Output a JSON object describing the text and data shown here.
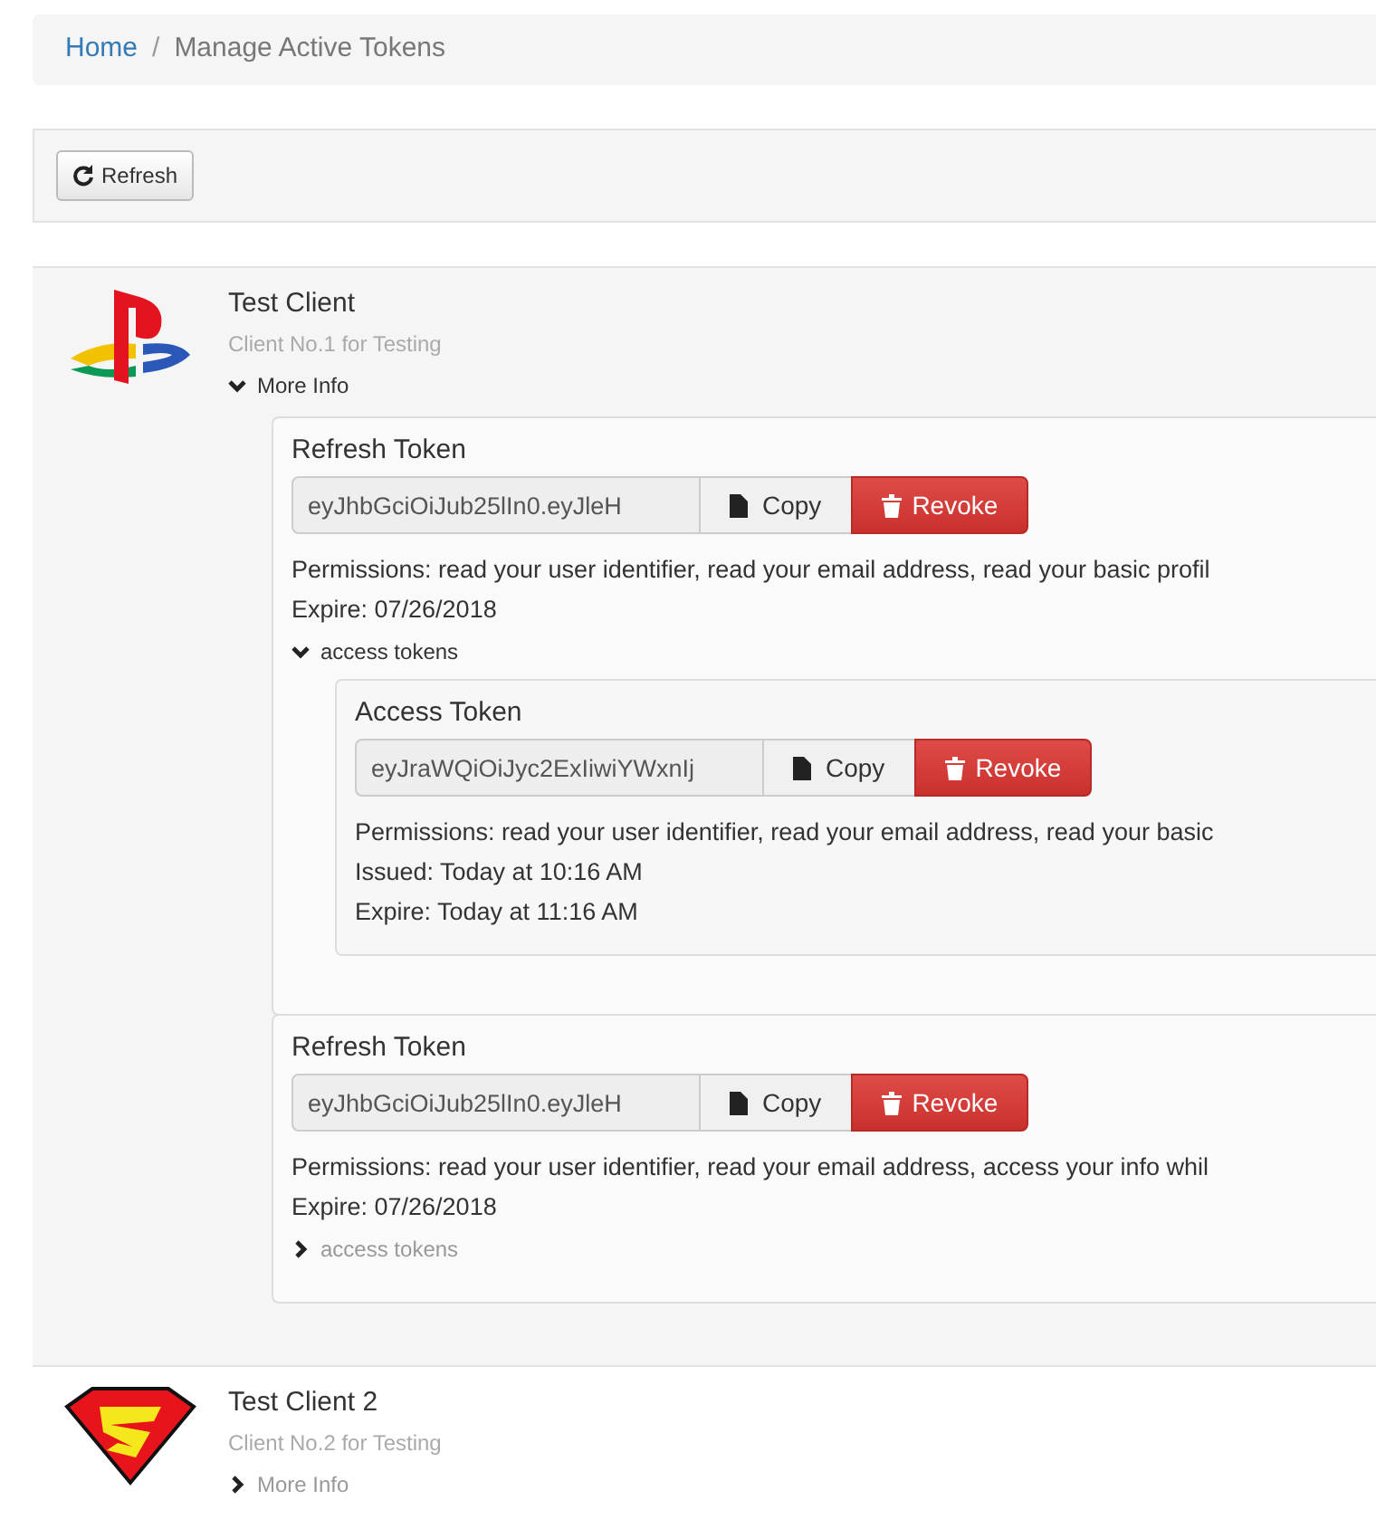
{
  "breadcrumb_separator": "/",
  "breadcrumb": [
    {
      "label": "Home",
      "kind": "link"
    },
    {
      "label": "Manage Active Tokens",
      "kind": "current"
    }
  ],
  "toolbar": {
    "refresh_button": "Refresh"
  },
  "clients": [
    {
      "kind": "emblem",
      "name": "Test Client",
      "description": "Client No.1 for Testing",
      "more_info": {
        "label": "More Info",
        "expanded": true
      },
      "refresh_tokens": [
        {
          "heading": "Refresh Token",
          "value": "eyJhbGciOiJub25lIn0.eyJleH",
          "copy_label": "Copy",
          "revoke_label": "Revoke",
          "permissions": "Permissions: read your user identifier, read your email address, read your basic profil",
          "expire": "Expire: 07/26/2018",
          "access_tokens": {
            "label": "access tokens",
            "expanded": true,
            "items": [
              {
                "heading": "Access Token",
                "value": "eyJraWQiOiJyc2ExIiwiYWxnIj",
                "copy_label": "Copy",
                "revoke_label": "Revoke",
                "permissions": "Permissions: read your user identifier, read your email address, read your basic",
                "issued": "Issued: Today at 10:16 AM",
                "expire": "Expire: Today at 11:16 AM"
              }
            ]
          }
        },
        {
          "heading": "Refresh Token",
          "value": "eyJhbGciOiJub25lIn0.eyJleH",
          "copy_label": "Copy",
          "revoke_label": "Revoke",
          "permissions": "Permissions: read your user identifier, read your email address, access your info whil",
          "expire": "Expire: 07/26/2018",
          "access_tokens": {
            "label": "access tokens",
            "expanded": false
          }
        }
      ]
    },
    {
      "kind": "shield",
      "name": "Test Client 2",
      "description": "Client No.2 for Testing",
      "more_info": {
        "label": "More Info",
        "expanded": false
      }
    }
  ]
}
